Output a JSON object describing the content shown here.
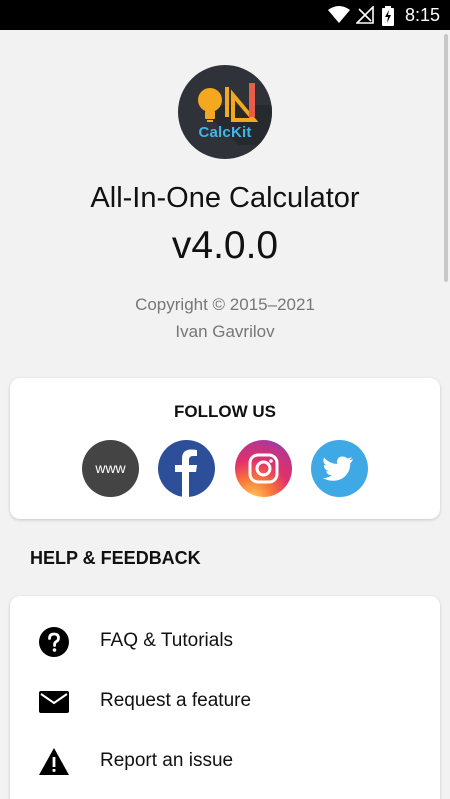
{
  "status_bar": {
    "time": "8:15",
    "icons": [
      "wifi-icon",
      "no-signal-icon",
      "battery-charging-icon"
    ]
  },
  "app": {
    "logo_text": "CalcKit",
    "name": "All-In-One Calculator",
    "version": "v4.0.0",
    "copyright": "Copyright © 2015–2021",
    "author": "Ivan Gavrilov"
  },
  "follow": {
    "title": "FOLLOW US",
    "links": [
      {
        "name": "website",
        "label": "www",
        "color": "#444444"
      },
      {
        "name": "facebook",
        "icon": "facebook-icon",
        "color": "#2d4f9a"
      },
      {
        "name": "instagram",
        "icon": "instagram-icon",
        "color": "#e1306c"
      },
      {
        "name": "twitter",
        "icon": "twitter-icon",
        "color": "#3fa9e6"
      }
    ]
  },
  "help": {
    "title": "HELP & FEEDBACK",
    "items": [
      {
        "label": "FAQ & Tutorials",
        "icon": "help-circle-icon"
      },
      {
        "label": "Request a feature",
        "icon": "mail-icon"
      },
      {
        "label": "Report an issue",
        "icon": "warning-icon"
      }
    ]
  }
}
